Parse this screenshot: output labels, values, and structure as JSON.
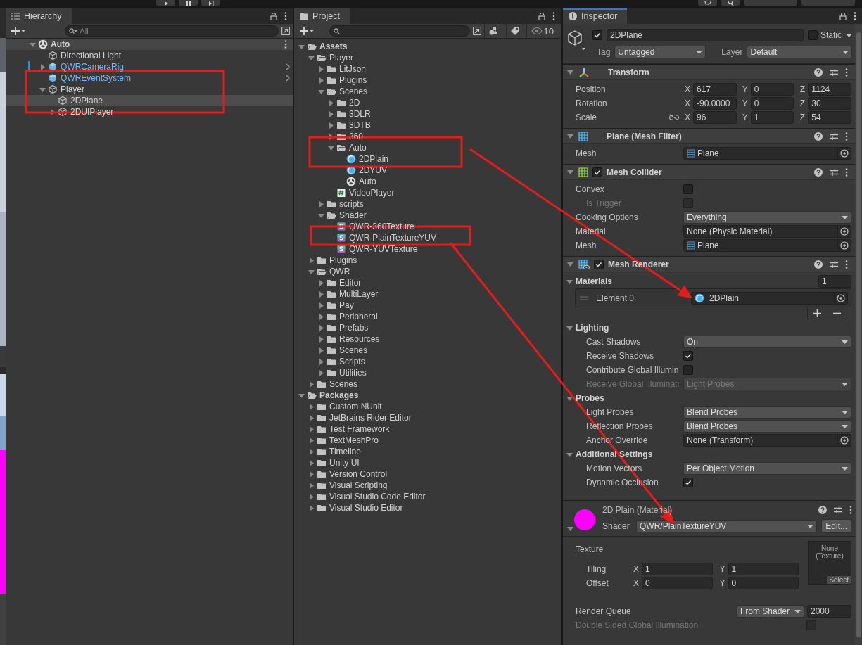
{
  "hierarchy": {
    "title": "Hierarchy",
    "search_placeholder": "All",
    "scene": {
      "name": "Auto",
      "expanded": true
    },
    "items": [
      {
        "name": "Directional Light",
        "prefab": false,
        "overridden": false,
        "selected": false
      },
      {
        "name": "QWRCameraRig",
        "expanded": false,
        "prefab": true,
        "overridden": true,
        "selected": false
      },
      {
        "name": "QWREventSystem",
        "prefab": true,
        "overridden": false,
        "selected": false
      },
      {
        "name": "Player",
        "expanded": true,
        "prefab": false,
        "overridden": false,
        "selected": false,
        "children": [
          {
            "name": "2DPlane",
            "prefab": false,
            "overridden": false,
            "selected": true
          },
          {
            "name": "2DUIPlayer",
            "expanded": false,
            "prefab": false,
            "overridden": false,
            "selected": false
          }
        ]
      }
    ]
  },
  "project": {
    "title": "Project",
    "hidden_count": "10",
    "tree": [
      {
        "name": "Assets",
        "kind": "folder",
        "expanded": true,
        "children": [
          {
            "name": "Player",
            "kind": "folder",
            "expanded": true,
            "children": [
              {
                "name": "LitJson",
                "kind": "folder",
                "expanded": false
              },
              {
                "name": "Plugins",
                "kind": "folder",
                "expanded": false
              },
              {
                "name": "Scenes",
                "kind": "folder",
                "expanded": true,
                "children": [
                  {
                    "name": "2D",
                    "kind": "folder",
                    "expanded": false
                  },
                  {
                    "name": "3DLR",
                    "kind": "folder",
                    "expanded": false
                  },
                  {
                    "name": "3DTB",
                    "kind": "folder",
                    "expanded": false
                  },
                  {
                    "name": "360",
                    "kind": "folder",
                    "expanded": false
                  },
                  {
                    "name": "Auto",
                    "kind": "folder",
                    "expanded": true,
                    "children": [
                      {
                        "name": "2DPlain",
                        "kind": "material"
                      },
                      {
                        "name": "2DYUV",
                        "kind": "material"
                      },
                      {
                        "name": "Auto",
                        "kind": "scene"
                      }
                    ]
                  },
                  {
                    "name": "VideoPlayer",
                    "kind": "script"
                  }
                ]
              },
              {
                "name": "scripts",
                "kind": "folder",
                "expanded": false
              },
              {
                "name": "Shader",
                "kind": "folder",
                "expanded": true,
                "children": [
                  {
                    "name": "QWR-360Texture",
                    "kind": "shader"
                  },
                  {
                    "name": "QWR-PlainTextureYUV",
                    "kind": "shader"
                  },
                  {
                    "name": "QWR-YUVTexture",
                    "kind": "shader"
                  }
                ]
              }
            ]
          },
          {
            "name": "Plugins",
            "kind": "folder",
            "expanded": false
          },
          {
            "name": "QWR",
            "kind": "folder",
            "expanded": true,
            "children": [
              {
                "name": "Editor",
                "kind": "folder",
                "expanded": false
              },
              {
                "name": "MultiLayer",
                "kind": "folder",
                "expanded": false
              },
              {
                "name": "Pay",
                "kind": "folder",
                "expanded": false
              },
              {
                "name": "Peripheral",
                "kind": "folder",
                "expanded": false
              },
              {
                "name": "Prefabs",
                "kind": "folder",
                "expanded": false
              },
              {
                "name": "Resources",
                "kind": "folder",
                "expanded": false
              },
              {
                "name": "Scenes",
                "kind": "folder",
                "expanded": false
              },
              {
                "name": "Scripts",
                "kind": "folder",
                "expanded": false
              },
              {
                "name": "Utilities",
                "kind": "folder",
                "expanded": false
              }
            ]
          },
          {
            "name": "Scenes",
            "kind": "folder",
            "expanded": false
          }
        ]
      },
      {
        "name": "Packages",
        "kind": "folder",
        "expanded": true,
        "children": [
          {
            "name": "Custom NUnit",
            "kind": "folder",
            "expanded": false
          },
          {
            "name": "JetBrains Rider Editor",
            "kind": "folder",
            "expanded": false
          },
          {
            "name": "Test Framework",
            "kind": "folder",
            "expanded": false
          },
          {
            "name": "TextMeshPro",
            "kind": "folder",
            "expanded": false
          },
          {
            "name": "Timeline",
            "kind": "folder",
            "expanded": false
          },
          {
            "name": "Unity UI",
            "kind": "folder",
            "expanded": false
          },
          {
            "name": "Version Control",
            "kind": "folder",
            "expanded": false
          },
          {
            "name": "Visual Scripting",
            "kind": "folder",
            "expanded": false
          },
          {
            "name": "Visual Studio Code Editor",
            "kind": "folder",
            "expanded": false
          },
          {
            "name": "Visual Studio Editor",
            "kind": "folder",
            "expanded": false
          }
        ]
      }
    ]
  },
  "inspector": {
    "title": "Inspector",
    "object": {
      "name": "2DPlane",
      "active": true,
      "static": false,
      "static_label": "Static",
      "tag_label": "Tag",
      "tag": "Untagged",
      "layer_label": "Layer",
      "layer": "Default"
    },
    "components": [
      {
        "kind": "transform",
        "title": "Transform",
        "expanded": true,
        "rows": [
          {
            "kind": "vector3",
            "label": "Position",
            "disabled": false,
            "values": [
              {
                "axis": "X",
                "value": "617"
              },
              {
                "axis": "Y",
                "value": "0"
              },
              {
                "axis": "Z",
                "value": "1124"
              }
            ]
          },
          {
            "kind": "vector3",
            "label": "Rotation",
            "disabled": false,
            "values": [
              {
                "axis": "X",
                "value": "-90.0000"
              },
              {
                "axis": "Y",
                "value": "0"
              },
              {
                "axis": "Z",
                "value": "30"
              }
            ]
          },
          {
            "kind": "scale",
            "label": "Scale",
            "disabled": false,
            "values": [
              {
                "axis": "X",
                "value": "96"
              },
              {
                "axis": "Y",
                "value": "1"
              },
              {
                "axis": "Z",
                "value": "54"
              }
            ]
          }
        ]
      },
      {
        "kind": "mesh_filter",
        "title": "Plane (Mesh Filter)",
        "expanded": true,
        "rows": [
          {
            "kind": "asset",
            "label": "Mesh",
            "value": "Plane",
            "disabled": false
          }
        ]
      },
      {
        "kind": "mesh_collider",
        "title": "Mesh Collider",
        "enabled": true,
        "expanded": true,
        "rows": [
          {
            "kind": "check",
            "label": "Convex",
            "checked": false,
            "disabled": false,
            "children": [
              {
                "kind": "check",
                "label": "Is Trigger",
                "checked": false,
                "disabled": true
              }
            ]
          },
          {
            "kind": "dropdown",
            "label": "Cooking Options",
            "value": "Everything",
            "disabled": false
          },
          {
            "kind": "object",
            "label": "Material",
            "value": "None (Physic Material)",
            "disabled": false
          },
          {
            "kind": "asset",
            "label": "Mesh",
            "value": "Plane",
            "disabled": false
          }
        ]
      },
      {
        "kind": "mesh_renderer",
        "title": "Mesh Renderer",
        "enabled": true,
        "expanded": true,
        "rows": [
          {
            "kind": "foldout",
            "label": "Materials",
            "expanded": true,
            "count": "1",
            "children": [
              {
                "kind": "slot",
                "label": "Element 0",
                "value": "2DPlain"
              }
            ]
          },
          {
            "kind": "foldout",
            "label": "Lighting",
            "expanded": true,
            "children": [
              {
                "kind": "dropdown",
                "label": "Cast Shadows",
                "value": "On",
                "disabled": false
              },
              {
                "kind": "check",
                "label": "Receive Shadows",
                "checked": true,
                "disabled": false
              },
              {
                "kind": "check",
                "label": "Contribute Global Illumin",
                "checked": false,
                "disabled": false
              },
              {
                "kind": "dropdown",
                "label": "Receive Global Illuminati",
                "value": "Light Probes",
                "disabled": true
              }
            ]
          },
          {
            "kind": "foldout",
            "label": "Probes",
            "expanded": true,
            "children": [
              {
                "kind": "dropdown",
                "label": "Light Probes",
                "value": "Blend Probes",
                "disabled": false
              },
              {
                "kind": "dropdown",
                "label": "Reflection Probes",
                "value": "Blend Probes",
                "disabled": false
              },
              {
                "kind": "object",
                "label": "Anchor Override",
                "value": "None (Transform)",
                "disabled": false
              }
            ]
          },
          {
            "kind": "foldout",
            "label": "Additional Settings",
            "expanded": true,
            "children": [
              {
                "kind": "dropdown",
                "label": "Motion Vectors",
                "value": "Per Object Motion",
                "disabled": false
              },
              {
                "kind": "check",
                "label": "Dynamic Occlusion",
                "checked": true,
                "disabled": false
              }
            ]
          }
        ]
      },
      {
        "kind": "material",
        "title": "2D Plain (Material)",
        "expanded": true,
        "shader_label": "Shader",
        "shader": "QWR/PlainTextureYUV",
        "edit": "Edit...",
        "texture": {
          "label": "Texture",
          "slot": "None (Texture)",
          "select": "Select",
          "rows": [
            {
              "label": "Tiling",
              "values": [
                {
                  "axis": "X",
                  "value": "1"
                },
                {
                  "axis": "Y",
                  "value": "1"
                }
              ]
            },
            {
              "label": "Offset",
              "values": [
                {
                  "axis": "X",
                  "value": "0"
                },
                {
                  "axis": "Y",
                  "value": "0"
                }
              ]
            }
          ]
        },
        "render_queue": {
          "label": "Render Queue",
          "mode": "From Shader",
          "value": "2000"
        },
        "double_sided": {
          "label": "Double Sided Global Illumination",
          "checked": false,
          "disabled": true
        }
      }
    ]
  }
}
